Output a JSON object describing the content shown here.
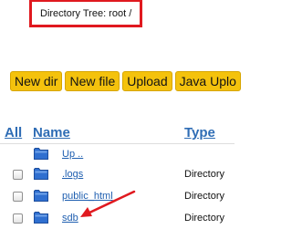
{
  "directory_tree": {
    "label": "Directory Tree: root /"
  },
  "toolbar": {
    "buttons": [
      "New dir",
      "New file",
      "Upload",
      "Java Uplo"
    ]
  },
  "table": {
    "headers": {
      "all": "All",
      "name": "Name",
      "type": "Type"
    },
    "rows": [
      {
        "name": "Up ..",
        "type": "",
        "has_checkbox": false
      },
      {
        "name": ".logs",
        "type": "Directory",
        "has_checkbox": true
      },
      {
        "name": "public_html",
        "type": "Directory",
        "has_checkbox": true
      },
      {
        "name": "sdb",
        "type": "Directory",
        "has_checkbox": true
      }
    ]
  },
  "icons": {
    "row_icon": "folder-icon",
    "annotation": "red-arrow-icon"
  },
  "colors": {
    "highlight_border": "#e0191f",
    "button_bg": "#f4c20d",
    "link": "#2f6db5",
    "folder": "#2f6fd0"
  }
}
